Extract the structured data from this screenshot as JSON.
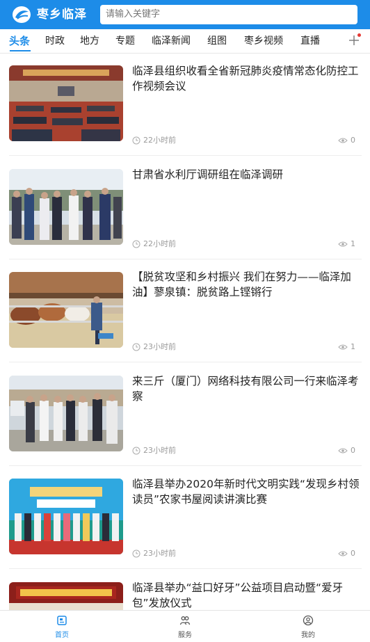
{
  "header": {
    "brand": "枣乡临泽",
    "search_placeholder": "请输入关键字",
    "accent_color": "#1d8ce8"
  },
  "tabs": [
    {
      "label": "头条",
      "active": true
    },
    {
      "label": "时政"
    },
    {
      "label": "地方"
    },
    {
      "label": "专题"
    },
    {
      "label": "临泽新闻"
    },
    {
      "label": "组图"
    },
    {
      "label": "枣乡视频"
    },
    {
      "label": "直播"
    }
  ],
  "add_channel_icon": "plus-icon",
  "articles": [
    {
      "title": "临泽县组织收看全省新冠肺炎疫情常态化防控工作视频会议",
      "time": "22小时前",
      "views": "0"
    },
    {
      "title": "甘肃省水利厅调研组在临泽调研",
      "time": "22小时前",
      "views": "1"
    },
    {
      "title": "【脱贫攻坚和乡村振兴 我们在努力——临泽加油】蓼泉镇：脱贫路上铿锵行",
      "time": "23小时前",
      "views": "1"
    },
    {
      "title": "来三斤（厦门）网络科技有限公司一行来临泽考察",
      "time": "23小时前",
      "views": "0"
    },
    {
      "title": "临泽县举办2020年新时代文明实践“发现乡村领读员”农家书屋阅读讲演比赛",
      "time": "23小时前",
      "views": "0"
    },
    {
      "title": "临泽县举办“益口好牙”公益项目启动暨“爱牙包”发放仪式",
      "time": "",
      "views": ""
    }
  ],
  "bottom_nav": [
    {
      "label": "首页",
      "icon": "news-icon",
      "active": true
    },
    {
      "label": "服务",
      "icon": "service-icon"
    },
    {
      "label": "我的",
      "icon": "user-icon"
    }
  ]
}
